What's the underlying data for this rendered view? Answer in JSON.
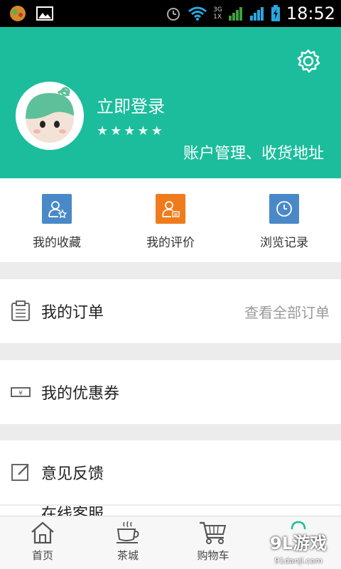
{
  "status_bar": {
    "time": "18:52",
    "net_top": "3G",
    "net_bottom": "1X",
    "net_g": "G"
  },
  "header": {
    "login": "立即登录",
    "account_link": "账户管理、收货地址",
    "rating_stars": 5,
    "bg_color": "#1bbd9c"
  },
  "quick_actions": [
    {
      "label": "我的收藏",
      "color": "#4a89c8"
    },
    {
      "label": "我的评价",
      "color": "#f07b1c"
    },
    {
      "label": "浏览记录",
      "color": "#4a89c8"
    }
  ],
  "menu": {
    "orders": {
      "label": "我的订单",
      "link": "查看全部订单"
    },
    "coupons": {
      "label": "我的优惠券"
    },
    "feedback": {
      "label": "意见反馈"
    },
    "partial": {
      "label": "在线客服"
    }
  },
  "tabbar": {
    "home": "首页",
    "tea_city": "茶城",
    "cart": "购物车"
  },
  "watermark": {
    "main": "9L游戏",
    "sub": "91danji.com"
  }
}
